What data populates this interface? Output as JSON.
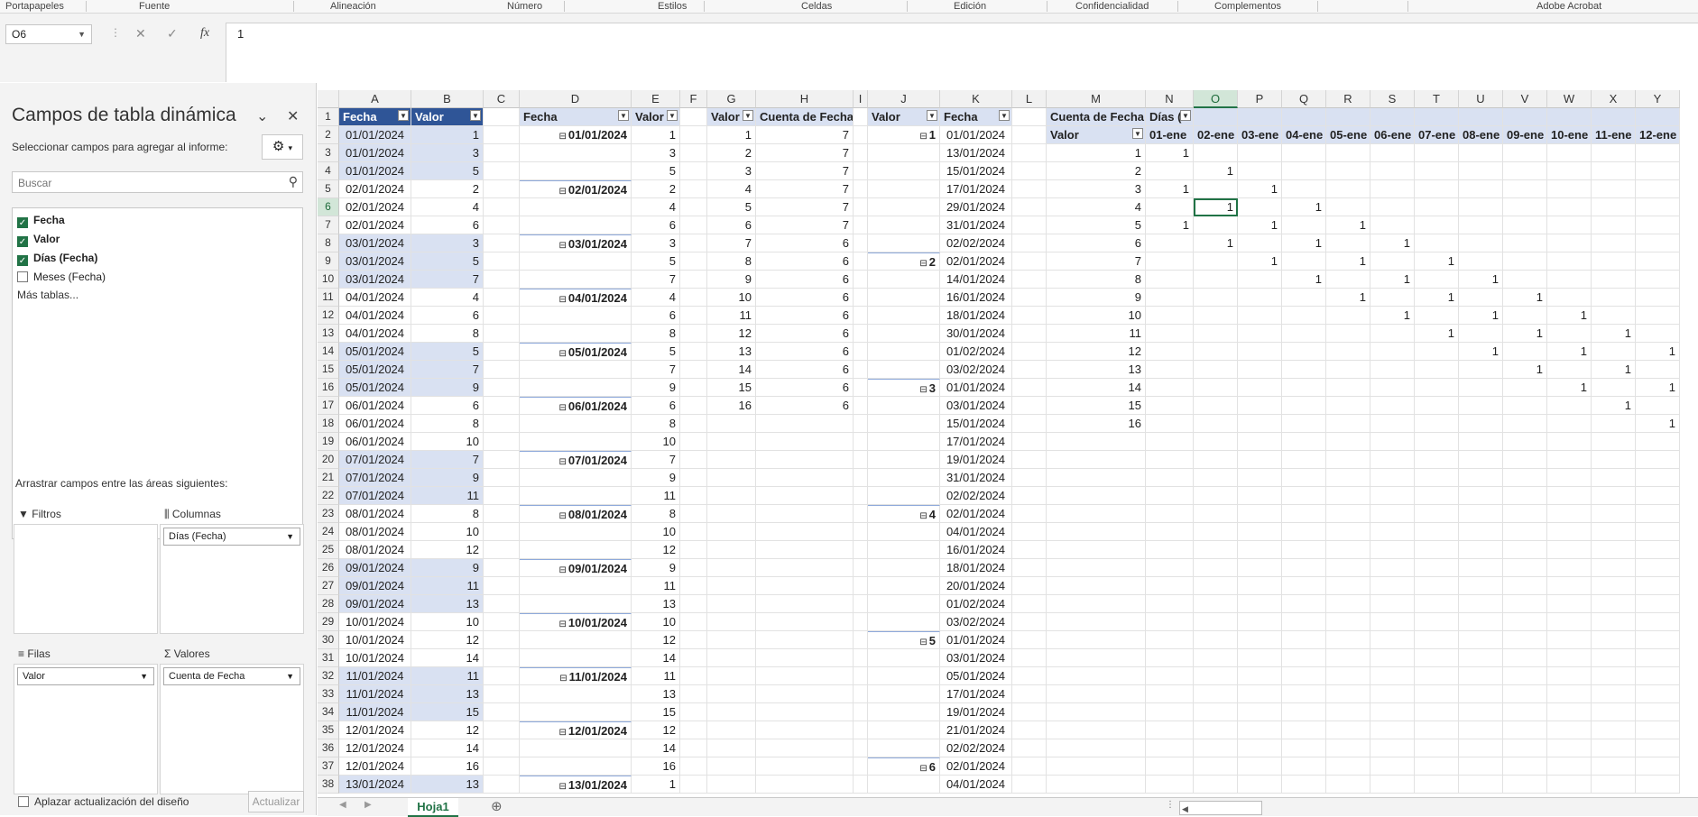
{
  "ribbon": {
    "groups": [
      "Portapapeles",
      "Fuente",
      "Alineación",
      "Número",
      "Estilos",
      "Celdas",
      "Edición",
      "Confidencialidad",
      "Complementos",
      "Adobe Acrobat"
    ]
  },
  "formula_bar": {
    "name_box": "O6",
    "cancel_icon": "✕",
    "enter_icon": "✓",
    "fx_label": "fx",
    "value": "1"
  },
  "pivot_pane": {
    "title": "Campos de tabla dinámica",
    "subtitle": "Seleccionar campos para agregar al informe:",
    "search_placeholder": "Buscar",
    "fields": [
      {
        "label": "Fecha",
        "checked": true
      },
      {
        "label": "Valor",
        "checked": true
      },
      {
        "label": "Días (Fecha)",
        "checked": true
      },
      {
        "label": "Meses (Fecha)",
        "checked": false
      }
    ],
    "more_tables": "Más tablas...",
    "drag_label": "Arrastrar campos entre las áreas siguientes:",
    "areas": {
      "filters": {
        "label": "Filtros",
        "items": []
      },
      "columns": {
        "label": "Columnas",
        "items": [
          "Días (Fecha)"
        ]
      },
      "rows": {
        "label": "Filas",
        "items": [
          "Valor"
        ]
      },
      "values": {
        "label": "Valores",
        "items": [
          "Cuenta de Fecha"
        ]
      }
    },
    "defer_label": "Aplazar actualización del diseño",
    "update_label": "Actualizar"
  },
  "sheet": {
    "columns": [
      "A",
      "B",
      "C",
      "D",
      "E",
      "F",
      "G",
      "H",
      "I",
      "J",
      "K",
      "L",
      "M",
      "N",
      "O",
      "P",
      "Q",
      "R",
      "S",
      "T",
      "U",
      "V",
      "W",
      "X",
      "Y"
    ],
    "selected_column": "O",
    "selected_row": 6,
    "rows": [
      1,
      2,
      3,
      4,
      5,
      6,
      7,
      8,
      9,
      10,
      11,
      12,
      13,
      14,
      15,
      16,
      17,
      18,
      19,
      20,
      21,
      22,
      23,
      24,
      25,
      26,
      27,
      28,
      29,
      30,
      31,
      32,
      33,
      34,
      35,
      36,
      37,
      38
    ],
    "table1": {
      "headers": [
        "Fecha",
        "Valor"
      ],
      "fecha": [
        "01/01/2024",
        "01/01/2024",
        "01/01/2024",
        "02/01/2024",
        "02/01/2024",
        "02/01/2024",
        "03/01/2024",
        "03/01/2024",
        "03/01/2024",
        "04/01/2024",
        "04/01/2024",
        "04/01/2024",
        "05/01/2024",
        "05/01/2024",
        "05/01/2024",
        "06/01/2024",
        "06/01/2024",
        "06/01/2024",
        "07/01/2024",
        "07/01/2024",
        "07/01/2024",
        "08/01/2024",
        "08/01/2024",
        "08/01/2024",
        "09/01/2024",
        "09/01/2024",
        "09/01/2024",
        "10/01/2024",
        "10/01/2024",
        "10/01/2024",
        "11/01/2024",
        "11/01/2024",
        "11/01/2024",
        "12/01/2024",
        "12/01/2024",
        "12/01/2024",
        "13/01/2024"
      ],
      "valor": [
        "1",
        "3",
        "5",
        "2",
        "4",
        "6",
        "3",
        "5",
        "7",
        "4",
        "6",
        "8",
        "5",
        "7",
        "9",
        "6",
        "8",
        "10",
        "7",
        "9",
        "11",
        "8",
        "10",
        "12",
        "9",
        "11",
        "13",
        "10",
        "12",
        "14",
        "11",
        "13",
        "15",
        "12",
        "14",
        "16",
        "13"
      ]
    },
    "pivot1": {
      "headers": [
        "Fecha",
        "Valor"
      ],
      "groups": [
        "01/01/2024",
        "02/01/2024",
        "03/01/2024",
        "04/01/2024",
        "05/01/2024",
        "06/01/2024",
        "07/01/2024",
        "08/01/2024",
        "09/01/2024",
        "10/01/2024",
        "11/01/2024",
        "12/01/2024",
        "13/01/2024"
      ],
      "values": [
        "1",
        "3",
        "5",
        "2",
        "4",
        "6",
        "3",
        "5",
        "7",
        "4",
        "6",
        "8",
        "5",
        "7",
        "9",
        "6",
        "8",
        "10",
        "7",
        "9",
        "11",
        "8",
        "10",
        "12",
        "9",
        "11",
        "13",
        "10",
        "12",
        "14",
        "11",
        "13",
        "15",
        "12",
        "14",
        "16",
        "1"
      ]
    },
    "pivot2": {
      "headers": [
        "Valor",
        "Cuenta de Fecha"
      ],
      "valor": [
        "1",
        "2",
        "3",
        "4",
        "5",
        "6",
        "7",
        "8",
        "9",
        "10",
        "11",
        "12",
        "13",
        "14",
        "15",
        "16"
      ],
      "cuenta": [
        "7",
        "7",
        "7",
        "7",
        "7",
        "7",
        "6",
        "6",
        "6",
        "6",
        "6",
        "6",
        "6",
        "6",
        "6",
        "6"
      ]
    },
    "pivot3": {
      "headers": [
        "Valor",
        "Fecha"
      ],
      "groups": [
        "1",
        "2",
        "3",
        "4",
        "5",
        "6"
      ],
      "fechas": [
        "01/01/2024",
        "13/01/2024",
        "15/01/2024",
        "17/01/2024",
        "29/01/2024",
        "31/01/2024",
        "02/02/2024",
        "02/01/2024",
        "14/01/2024",
        "16/01/2024",
        "18/01/2024",
        "30/01/2024",
        "01/02/2024",
        "03/02/2024",
        "01/01/2024",
        "03/01/2024",
        "15/01/2024",
        "17/01/2024",
        "19/01/2024",
        "31/01/2024",
        "02/02/2024",
        "02/01/2024",
        "04/01/2024",
        "16/01/2024",
        "18/01/2024",
        "20/01/2024",
        "01/02/2024",
        "03/02/2024",
        "01/01/2024",
        "03/01/2024",
        "05/01/2024",
        "17/01/2024",
        "19/01/2024",
        "21/01/2024",
        "02/02/2024",
        "02/01/2024",
        "04/01/2024"
      ]
    },
    "pivot4": {
      "corner": "Cuenta de Fecha",
      "col_field": "Días (",
      "row_field": "Valor",
      "days": [
        "01-ene",
        "02-ene",
        "03-ene",
        "04-ene",
        "05-ene",
        "06-ene",
        "07-ene",
        "08-ene",
        "09-ene",
        "10-ene",
        "11-ene",
        "12-ene"
      ],
      "row_values": [
        "1",
        "2",
        "3",
        "4",
        "5",
        "6",
        "7",
        "8",
        "9",
        "10",
        "11",
        "12",
        "13",
        "14",
        "15",
        "16"
      ],
      "matrix": [
        [
          1,
          0,
          0,
          0,
          0,
          0,
          0,
          0,
          0,
          0,
          0,
          0
        ],
        [
          0,
          1,
          0,
          0,
          0,
          0,
          0,
          0,
          0,
          0,
          0,
          0
        ],
        [
          1,
          0,
          1,
          0,
          0,
          0,
          0,
          0,
          0,
          0,
          0,
          0
        ],
        [
          0,
          1,
          0,
          1,
          0,
          0,
          0,
          0,
          0,
          0,
          0,
          0
        ],
        [
          1,
          0,
          1,
          0,
          1,
          0,
          0,
          0,
          0,
          0,
          0,
          0
        ],
        [
          0,
          1,
          0,
          1,
          0,
          1,
          0,
          0,
          0,
          0,
          0,
          0
        ],
        [
          0,
          0,
          1,
          0,
          1,
          0,
          1,
          0,
          0,
          0,
          0,
          0
        ],
        [
          0,
          0,
          0,
          1,
          0,
          1,
          0,
          1,
          0,
          0,
          0,
          0
        ],
        [
          0,
          0,
          0,
          0,
          1,
          0,
          1,
          0,
          1,
          0,
          0,
          0
        ],
        [
          0,
          0,
          0,
          0,
          0,
          1,
          0,
          1,
          0,
          1,
          0,
          0
        ],
        [
          0,
          0,
          0,
          0,
          0,
          0,
          1,
          0,
          1,
          0,
          1,
          0
        ],
        [
          0,
          0,
          0,
          0,
          0,
          0,
          0,
          1,
          0,
          1,
          0,
          1
        ],
        [
          0,
          0,
          0,
          0,
          0,
          0,
          0,
          0,
          1,
          0,
          1,
          0
        ],
        [
          0,
          0,
          0,
          0,
          0,
          0,
          0,
          0,
          0,
          1,
          0,
          1
        ],
        [
          0,
          0,
          0,
          0,
          0,
          0,
          0,
          0,
          0,
          0,
          1,
          0
        ],
        [
          0,
          0,
          0,
          0,
          0,
          0,
          0,
          0,
          0,
          0,
          0,
          1
        ]
      ]
    }
  },
  "sheet_tabs": {
    "active": "Hoja1"
  }
}
